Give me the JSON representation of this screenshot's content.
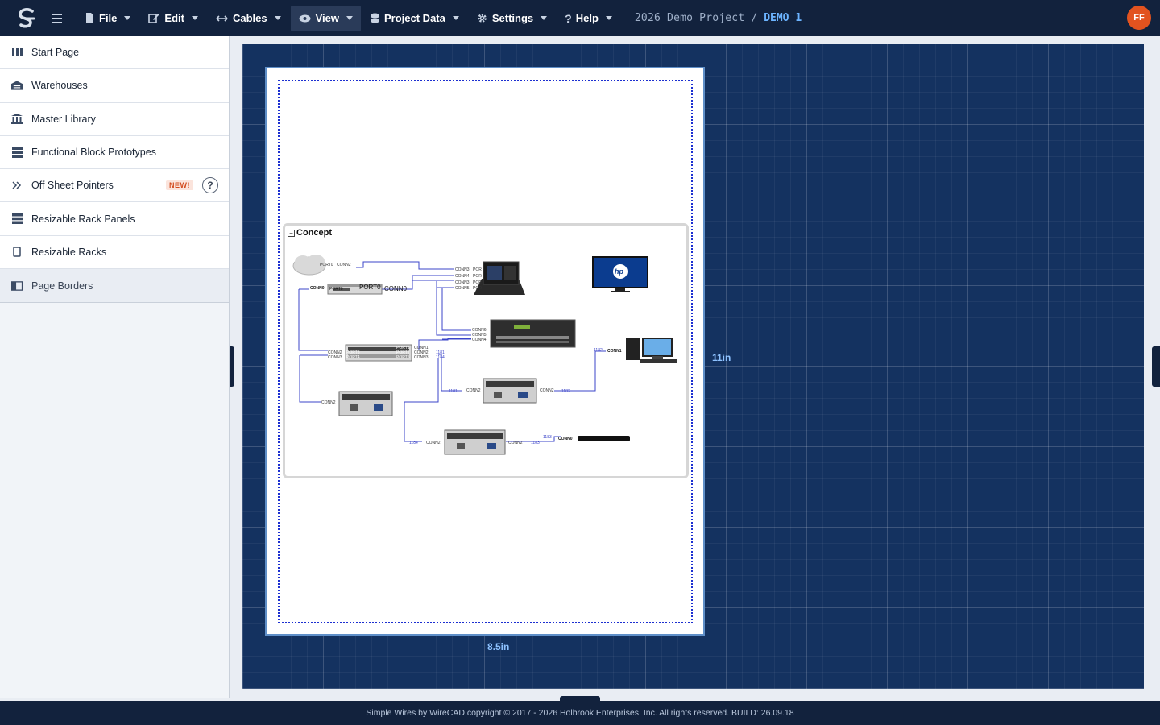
{
  "topbar": {
    "menus": [
      {
        "label": "File",
        "icon": "file-icon"
      },
      {
        "label": "Edit",
        "icon": "edit-icon"
      },
      {
        "label": "Cables",
        "icon": "arrows-horizontal-icon"
      },
      {
        "label": "View",
        "icon": "eye-icon"
      },
      {
        "label": "Project Data",
        "icon": "database-icon"
      },
      {
        "label": "Settings",
        "icon": "gear-icon"
      },
      {
        "label": "Help",
        "icon": "question-icon"
      }
    ],
    "project_name": "2026 Demo Project",
    "separator": "/",
    "sheet_name": "DEMO 1",
    "user_initials": "FF",
    "avatar_color": "#e2531f"
  },
  "sidebar": {
    "items": [
      {
        "label": "Start Page",
        "icon": "columns-icon"
      },
      {
        "label": "Warehouses",
        "icon": "warehouse-icon"
      },
      {
        "label": "Master Library",
        "icon": "library-icon"
      },
      {
        "label": "Functional Block Prototypes",
        "icon": "layers-icon"
      },
      {
        "label": "Off Sheet Pointers",
        "icon": "double-chevron-right-icon",
        "badge": "NEW!",
        "help": "?"
      },
      {
        "label": "Resizable Rack Panels",
        "icon": "rack-panel-icon"
      },
      {
        "label": "Resizable Racks",
        "icon": "rack-icon"
      },
      {
        "label": "Page Borders",
        "icon": "page-border-icon",
        "selected": true
      }
    ]
  },
  "canvas": {
    "width_label": "8.5in",
    "height_label": "11in",
    "group_title": "Concept",
    "collapse_symbol": "−",
    "connector_labels": {
      "port0": "PORT0",
      "conn0": "CONN0",
      "conn1": "CONN1",
      "conn2": "CONN2",
      "conn3": "CONN3",
      "conn4": "CONN4",
      "conn5": "CONN5",
      "conn6": "CONN6",
      "port1": "PORT1",
      "port2": "PORT2",
      "port3": "PORT3",
      "port4": "PORT4",
      "port5": "PORT5",
      "port1_abbr": "POR",
      "c1181": "1181",
      "c1182": "1182",
      "c1183": "1183",
      "c1184": "1184",
      "monitor_logo": "hp"
    }
  },
  "footer": {
    "text": "Simple Wires by WireCAD copyright © 2017 - 2026 Holbrook Enterprises, Inc. All rights reserved. BUILD: 26.09.18"
  },
  "colors": {
    "topbar_bg": "#12223d",
    "canvas_bg": "#143260",
    "sheet_border": "#5f8fc8",
    "page_border_dots": "#1c2fd1",
    "wire": "#3b44c9",
    "dim_label": "#8ec2ff"
  }
}
